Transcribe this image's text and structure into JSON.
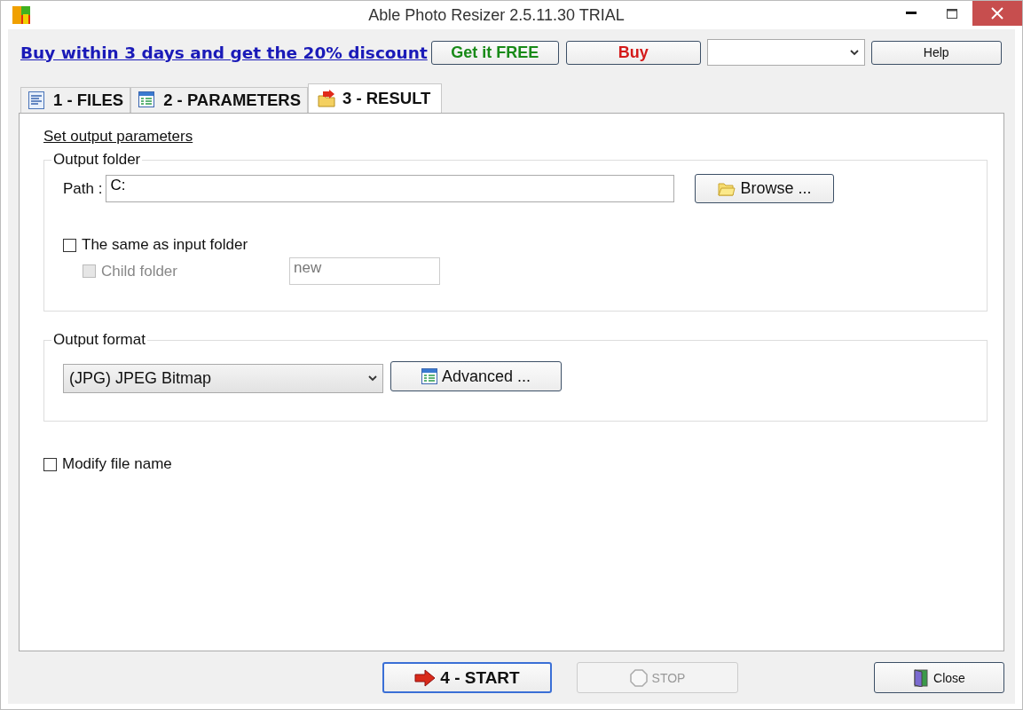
{
  "window": {
    "title": "Able Photo Resizer 2.5.11.30 TRIAL"
  },
  "promo": {
    "link": "Buy within 3 days and get the 20% discount",
    "buttons": [
      {
        "label": "Get it FREE",
        "kind": "free"
      },
      {
        "label": "Buy",
        "kind": "buy"
      }
    ],
    "help": "Help"
  },
  "tabs": [
    {
      "label": "1 - FILES",
      "selected": false
    },
    {
      "label": "2 - PARAMETERS",
      "selected": false
    },
    {
      "label": "3 - RESULT",
      "selected": true
    }
  ],
  "panel": {
    "heading": "Set output parameters",
    "output_folder": {
      "title": "Output folder",
      "path_label": "Path :",
      "path_value": "C:",
      "browse": "Browse ...",
      "same_as_input": {
        "label": "The same as input folder",
        "checked": false,
        "disabled": false
      },
      "child_folder": {
        "label": "Child folder",
        "checked": false,
        "disabled": true
      },
      "child_name": {
        "value": "new",
        "disabled": true
      }
    },
    "output_format": {
      "title": "Output format",
      "format": "(JPG) JPEG Bitmap",
      "advanced": "Advanced ..."
    },
    "modify_file_name": {
      "label": "Modify file name",
      "checked": false,
      "disabled": false
    }
  },
  "bottom_buttons": [
    {
      "label": "4 - START",
      "kind": "start",
      "disabled": false
    },
    {
      "label": "STOP",
      "kind": "stop",
      "disabled": true
    },
    {
      "label": "Close",
      "kind": "close",
      "disabled": false
    }
  ]
}
